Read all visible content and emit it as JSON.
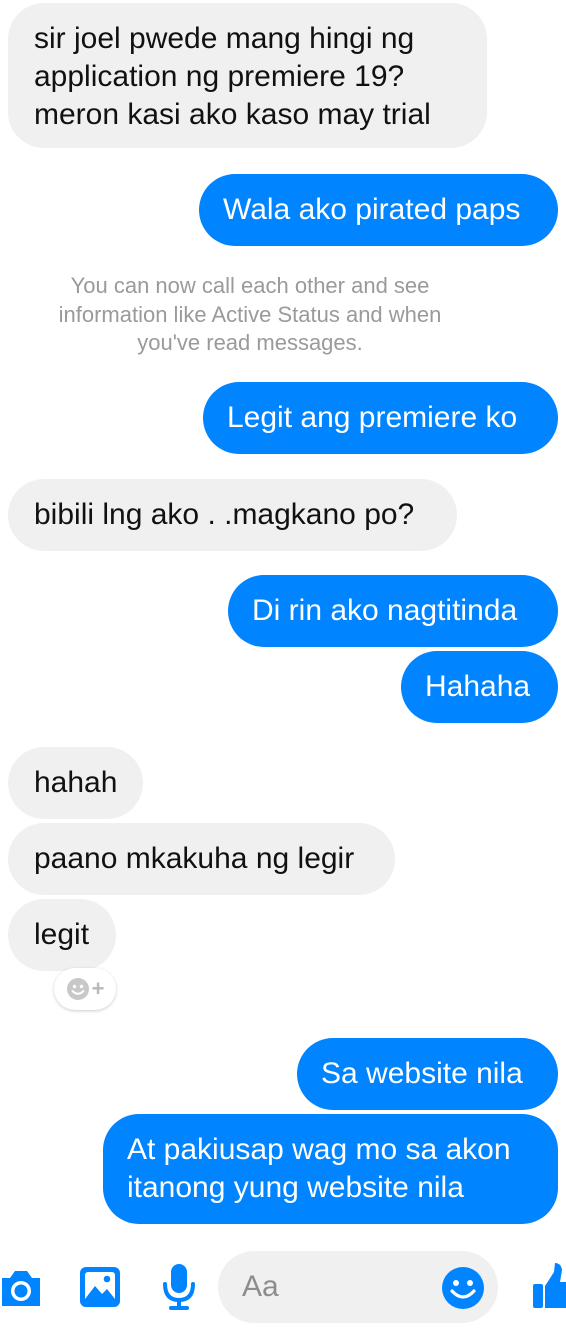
{
  "conversation": {
    "messages": [
      {
        "direction": "incoming",
        "text": "sir joel    pwede mang hingi ng\napplication ng premiere 19?\nmeron kasi ako kaso may trial"
      },
      {
        "direction": "outgoing",
        "text": "Wala ako pirated paps"
      },
      {
        "direction": "outgoing",
        "text": "Legit ang premiere ko"
      },
      {
        "direction": "incoming",
        "text": "bibili lng ako . .magkano po?"
      },
      {
        "direction": "outgoing",
        "text": "Di rin ako nagtitinda"
      },
      {
        "direction": "outgoing",
        "text": "Hahaha"
      },
      {
        "direction": "incoming",
        "text": "hahah"
      },
      {
        "direction": "incoming",
        "text": "paano mkakuha ng legir"
      },
      {
        "direction": "incoming",
        "text": "legit"
      },
      {
        "direction": "outgoing",
        "text": "Sa website nila"
      },
      {
        "direction": "outgoing",
        "text": "At pakiusap wag mo sa akon\nitanong yung website nila"
      }
    ],
    "system_notice": "You can now call each other and see\ninformation like Active Status and when\nyou've read messages.",
    "reaction_button": {
      "icon": "smiley-add-icon",
      "label": "+"
    }
  },
  "composer": {
    "placeholder": "Aa",
    "icons": [
      "camera-icon",
      "gallery-icon",
      "microphone-icon",
      "emoji-icon",
      "like-icon"
    ]
  },
  "colors": {
    "outgoing_bubble": "#0084ff",
    "incoming_bubble": "#f0f0f0",
    "incoming_text": "#111111",
    "system_text": "#9a9a9a",
    "accent": "#0084ff"
  }
}
